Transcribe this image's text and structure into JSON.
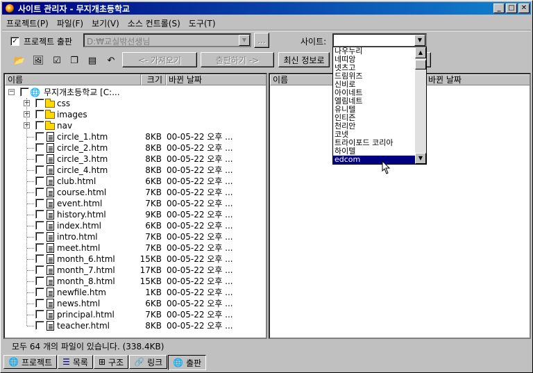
{
  "window": {
    "title": "사이트 관리자 - 무지개초등학교"
  },
  "title_buttons": {
    "minimize": "_",
    "maximize": "□",
    "close": "✕"
  },
  "menu": [
    {
      "label": "프로젝트(P)"
    },
    {
      "label": "파일(F)"
    },
    {
      "label": "보기(V)"
    },
    {
      "label": "소스 컨트롤(S)"
    },
    {
      "label": "도구(T)"
    }
  ],
  "publish": {
    "checkbox_label": "프로젝트 출판",
    "checked": true,
    "path_value": "D:₩교실밖선생님",
    "browse_label": "..."
  },
  "site": {
    "label": "사이트:",
    "value": ""
  },
  "toolbar": {
    "get_label": "<- 가져오기",
    "publish_label": "출판하기 ->",
    "refresh_label": "최신 정보로"
  },
  "left_panel": {
    "headers": {
      "name": "이름",
      "size": "크기",
      "date": "바뀐 날짜"
    },
    "root": "무지개초등학교 [C:...",
    "folders": [
      "css",
      "images",
      "nav"
    ],
    "files": [
      {
        "name": "circle_1.htm",
        "size": "8KB",
        "date": "00-05-22 오후 ..."
      },
      {
        "name": "circle_2.htm",
        "size": "8KB",
        "date": "00-05-22 오후 ..."
      },
      {
        "name": "circle_3.htm",
        "size": "8KB",
        "date": "00-05-22 오후 ..."
      },
      {
        "name": "circle_4.htm",
        "size": "8KB",
        "date": "00-05-22 오후 ..."
      },
      {
        "name": "club.html",
        "size": "6KB",
        "date": "00-05-22 오후 ..."
      },
      {
        "name": "course.html",
        "size": "7KB",
        "date": "00-05-22 오후 ..."
      },
      {
        "name": "event.html",
        "size": "7KB",
        "date": "00-05-22 오후 ..."
      },
      {
        "name": "history.html",
        "size": "9KB",
        "date": "00-05-22 오후 ..."
      },
      {
        "name": "index.html",
        "size": "6KB",
        "date": "00-05-22 오후 ..."
      },
      {
        "name": "intro.html",
        "size": "7KB",
        "date": "00-05-22 오후 ..."
      },
      {
        "name": "meet.html",
        "size": "7KB",
        "date": "00-05-22 오후 ..."
      },
      {
        "name": "month_6.html",
        "size": "15KB",
        "date": "00-05-22 오후 ..."
      },
      {
        "name": "month_7.html",
        "size": "17KB",
        "date": "00-05-22 오후 ..."
      },
      {
        "name": "month_8.html",
        "size": "15KB",
        "date": "00-05-22 오후 ..."
      },
      {
        "name": "newfile.htm",
        "size": "1KB",
        "date": "00-05-22 오후 ..."
      },
      {
        "name": "news.html",
        "size": "6KB",
        "date": "00-05-22 오후 ..."
      },
      {
        "name": "principal.html",
        "size": "7KB",
        "date": "00-05-22 오후 ..."
      },
      {
        "name": "teacher.html",
        "size": "8KB",
        "date": "00-05-22 오후 ..."
      }
    ]
  },
  "right_panel": {
    "headers": {
      "name": "이름",
      "date": "바뀐 날짜"
    }
  },
  "site_dropdown": {
    "items": [
      "나우누리",
      "네띠앙",
      "넷츠고",
      "드림위즈",
      "신비로",
      "아이네트",
      "엘림네트",
      "유니텔",
      "인티즌",
      "천리안",
      "코넷",
      "트라이포드 코리아",
      "하이텔",
      "edcom"
    ],
    "selected": "edcom"
  },
  "status": {
    "text": "모두 64 개의 파일이 있습니다. (338.4KB)"
  },
  "tabs": [
    {
      "label": "프로젝트",
      "active": false
    },
    {
      "label": "목록",
      "active": false
    },
    {
      "label": "구조",
      "active": false
    },
    {
      "label": "링크",
      "active": false
    },
    {
      "label": "출판",
      "active": true
    }
  ]
}
